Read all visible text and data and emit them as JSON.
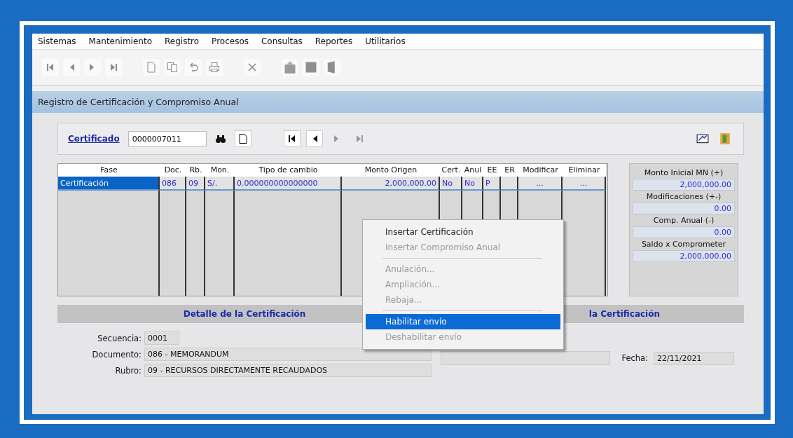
{
  "menu_bar": [
    {
      "label": "Sistemas"
    },
    {
      "label": "Mantenimiento"
    },
    {
      "label": "Registro"
    },
    {
      "label": "Procesos"
    },
    {
      "label": "Consultas"
    },
    {
      "label": "Reportes"
    },
    {
      "label": "Utilitarios"
    }
  ],
  "form": {
    "title": "Registro de Certificación y Compromiso Anual"
  },
  "certificado": {
    "label": "Certificado",
    "value": "0000007011"
  },
  "grid": {
    "columns": [
      "Fase",
      "Doc.",
      "Rb.",
      "Mon.",
      "Tipo de cambio",
      "Monto Origen",
      "Cert.",
      "Anul",
      "EE",
      "ER",
      "Modificar",
      "Eliminar"
    ],
    "rows": [
      {
        "selected": true,
        "cells": [
          "Certificación",
          "086",
          "09",
          "S/.",
          "0.000000000000000",
          "2,000,000.00",
          "No",
          "No",
          "P",
          null,
          "...",
          "..."
        ]
      }
    ]
  },
  "summary": [
    {
      "label": "Monto Inicial MN (+)",
      "value": "2,000,000.00"
    },
    {
      "label": "Modificaciones (+-)",
      "value": "0.00"
    },
    {
      "label": "Comp. Anual (-)",
      "value": "0.00"
    },
    {
      "label": "Saldo x Comprometer",
      "value": "2,000,000.00"
    }
  ],
  "detail": {
    "title": "Detalle de la Certificación",
    "fields": [
      {
        "label": "Secuencia:",
        "value": "0001"
      },
      {
        "label": "Documento:",
        "value": "086 - MEMORANDUM"
      },
      {
        "label": "Rubro:",
        "value": "09 - RECURSOS DIRECTAMENTE RECAUDADOS"
      }
    ]
  },
  "detail_right": {
    "title": "la Certificación",
    "fields": [
      {
        "label": "Fecha:",
        "value": "22/11/2021"
      }
    ]
  },
  "context_menu": [
    {
      "kind": "item",
      "label": "Insertar Certificación",
      "disabled": false,
      "selected": false
    },
    {
      "kind": "item",
      "label": "Insertar Compromiso Anual",
      "disabled": true,
      "selected": false
    },
    {
      "kind": "separator"
    },
    {
      "kind": "item",
      "label": "Anulación...",
      "disabled": true,
      "selected": false
    },
    {
      "kind": "item",
      "label": "Ampliación...",
      "disabled": true,
      "selected": false
    },
    {
      "kind": "item",
      "label": "Rebaja...",
      "disabled": true,
      "selected": false
    },
    {
      "kind": "separator"
    },
    {
      "kind": "item",
      "label": "Habilitar envío",
      "disabled": false,
      "selected": true
    },
    {
      "kind": "item",
      "label": "Deshabilitar envío",
      "disabled": true,
      "selected": false
    }
  ]
}
